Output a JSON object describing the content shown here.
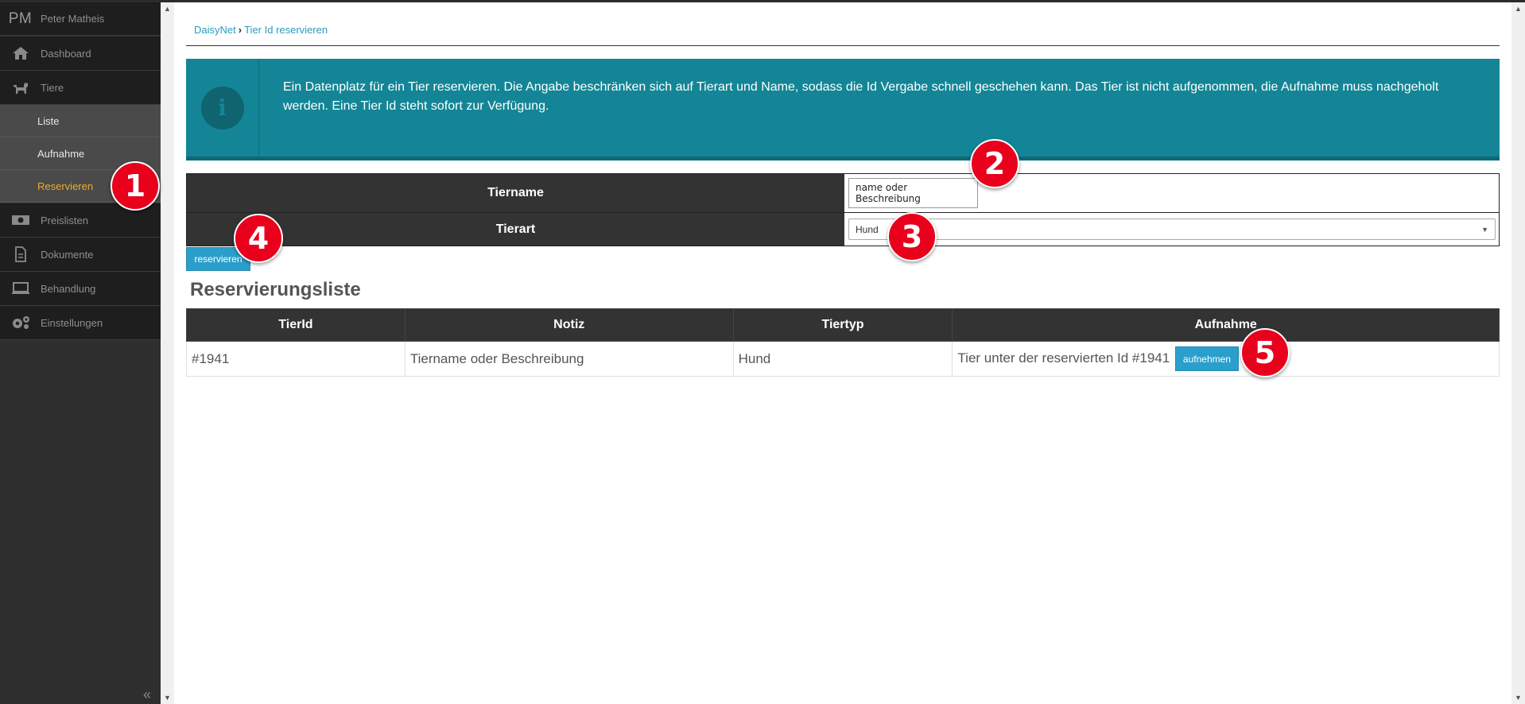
{
  "user": {
    "initials": "PM",
    "name": "Peter Matheis"
  },
  "sidebar": {
    "items": [
      {
        "label": "Dashboard",
        "icon": "home-icon"
      },
      {
        "label": "Tiere",
        "icon": "dog-icon"
      },
      {
        "label": "Preislisten",
        "icon": "money-icon"
      },
      {
        "label": "Dokumente",
        "icon": "document-icon"
      },
      {
        "label": "Behandlung",
        "icon": "laptop-icon"
      },
      {
        "label": "Einstellungen",
        "icon": "gears-icon"
      }
    ],
    "tiere_sub": [
      {
        "label": "Liste"
      },
      {
        "label": "Aufnahme"
      },
      {
        "label": "Reservieren",
        "active": true
      }
    ],
    "collapse": "«"
  },
  "breadcrumb": {
    "root": "DaisyNet",
    "sep": "›",
    "current": "Tier Id reservieren"
  },
  "info": {
    "text": "Ein Datenplatz für ein Tier reservieren. Die Angabe beschränken sich auf Tierart und Name, sodass die Id Vergabe schnell geschehen kann. Das Tier ist nicht aufgenommen, die Aufnahme muss nachgeholt werden. Eine Tier Id steht sofort zur Verfügung."
  },
  "form": {
    "tiername_label": "Tiername",
    "tiername_value": "name oder Beschreibung",
    "tierart_label": "Tierart",
    "tierart_value": "Hund",
    "submit_label": "reservieren"
  },
  "reservations": {
    "title": "Reservierungsliste",
    "headers": [
      "TierId",
      "Notiz",
      "Tiertyp",
      "Aufnahme"
    ],
    "rows": [
      {
        "id": "#1941",
        "notiz": "Tiername oder Beschreibung",
        "typ": "Hund",
        "aufnahme_text": "Tier unter der reservierten Id #1941",
        "aufnahme_button": "aufnehmen"
      }
    ]
  },
  "annotations": [
    "1",
    "2",
    "3",
    "4",
    "5"
  ],
  "colors": {
    "accent": "#2a9fcb",
    "info_bg": "#138596",
    "active_menu": "#f0a92a",
    "badge": "#e8001c"
  }
}
